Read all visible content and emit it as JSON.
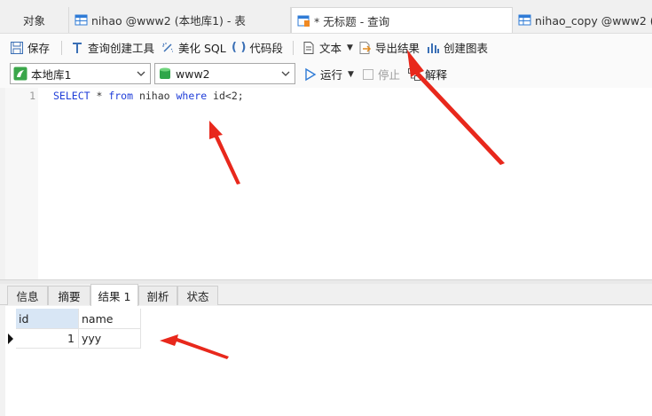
{
  "tabs": [
    {
      "label": "对象",
      "active": false
    },
    {
      "label": "nihao @www2 (本地库1) - 表",
      "active": false
    },
    {
      "label": "* 无标题 - 查询",
      "active": true
    },
    {
      "label": "nihao_copy @www2 (本",
      "active": false
    }
  ],
  "toolbar": {
    "save": "保存",
    "query_builder": "查询创建工具",
    "beautify_sql": "美化 SQL",
    "code_snippet": "代码段",
    "text": "文本",
    "export_result": "导出结果",
    "create_chart": "创建图表"
  },
  "connection": {
    "selected": "本地库1",
    "database": "www2",
    "run": "运行",
    "stop": "停止",
    "explain": "解释"
  },
  "editor": {
    "line_number": "1",
    "sql": {
      "select": "SELECT",
      "star": " * ",
      "from": "from",
      "table": " nihao ",
      "where": "where",
      "cond": " id<2;"
    }
  },
  "result_tabs": [
    {
      "label": "信息",
      "active": false
    },
    {
      "label": "摘要",
      "active": false
    },
    {
      "label": "结果 1",
      "active": true
    },
    {
      "label": "剖析",
      "active": false
    },
    {
      "label": "状态",
      "active": false
    }
  ],
  "grid": {
    "columns": [
      "id",
      "name"
    ],
    "rows": [
      [
        "1",
        "yyy"
      ]
    ]
  },
  "colors": {
    "keyword": "#1f3dd8",
    "annotation_arrow": "#e8281c",
    "header_selected": "#d8e6f5"
  }
}
